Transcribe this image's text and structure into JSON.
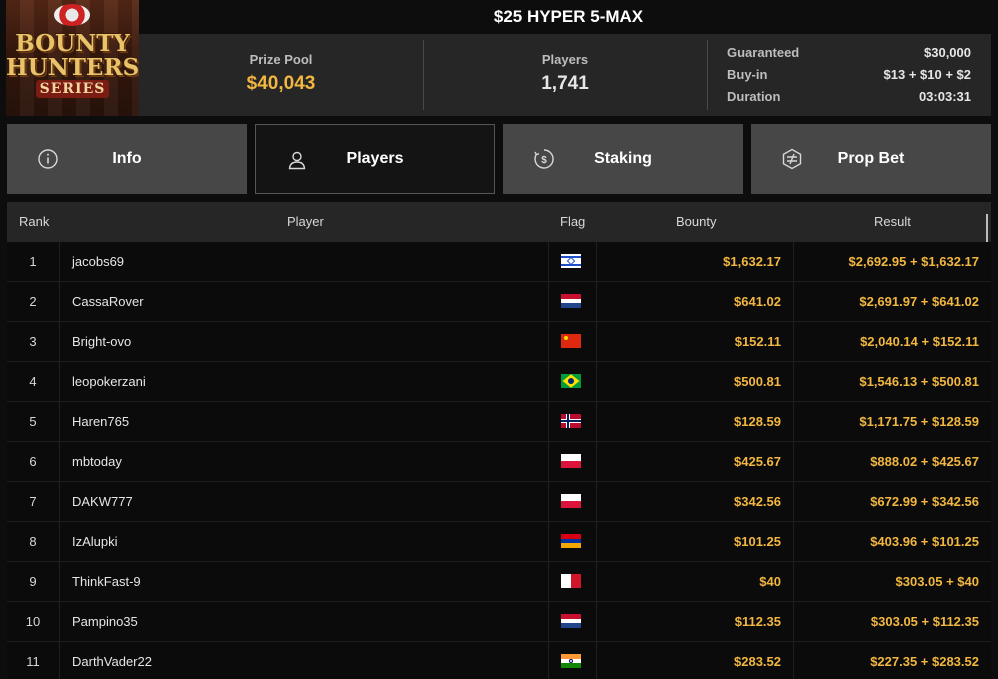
{
  "logo": {
    "line1": "BOUNTY",
    "line2": "HUNTERS",
    "line3": "SERIES"
  },
  "tournament": {
    "title": "$25 HYPER 5-MAX"
  },
  "stats": {
    "prize_pool_label": "Prize Pool",
    "prize_pool_value": "$40,043",
    "players_label": "Players",
    "players_value": "1,741",
    "guaranteed_label": "Guaranteed",
    "guaranteed_value": "$30,000",
    "buyin_label": "Buy-in",
    "buyin_value": "$13 + $10 + $2",
    "duration_label": "Duration",
    "duration_value": "03:03:31"
  },
  "tabs": [
    {
      "label": "Info",
      "icon": "info-icon",
      "active": false
    },
    {
      "label": "Players",
      "icon": "user-icon",
      "active": true
    },
    {
      "label": "Staking",
      "icon": "staking-icon",
      "active": false
    },
    {
      "label": "Prop Bet",
      "icon": "prop-bet-icon",
      "active": false
    }
  ],
  "table": {
    "headers": {
      "rank": "Rank",
      "player": "Player",
      "flag": "Flag",
      "bounty": "Bounty",
      "result": "Result"
    },
    "rows": [
      {
        "rank": "1",
        "player": "jacobs69",
        "flag": "israel-flag",
        "bounty": "$1,632.17",
        "result": "$2,692.95 + $1,632.17"
      },
      {
        "rank": "2",
        "player": "CassaRover",
        "flag": "netherlands-flag",
        "bounty": "$641.02",
        "result": "$2,691.97 + $641.02"
      },
      {
        "rank": "3",
        "player": "Bright-ovo",
        "flag": "china-flag",
        "bounty": "$152.11",
        "result": "$2,040.14 + $152.11"
      },
      {
        "rank": "4",
        "player": "leopokerzani",
        "flag": "brazil-flag",
        "bounty": "$500.81",
        "result": "$1,546.13 + $500.81"
      },
      {
        "rank": "5",
        "player": "Haren765",
        "flag": "norway-flag",
        "bounty": "$128.59",
        "result": "$1,171.75 + $128.59"
      },
      {
        "rank": "6",
        "player": "mbtoday",
        "flag": "poland-flag",
        "bounty": "$425.67",
        "result": "$888.02 + $425.67"
      },
      {
        "rank": "7",
        "player": "DAKW777",
        "flag": "poland-flag",
        "bounty": "$342.56",
        "result": "$672.99 + $342.56"
      },
      {
        "rank": "8",
        "player": "IzAlupki",
        "flag": "armenia-flag",
        "bounty": "$101.25",
        "result": "$403.96 + $101.25"
      },
      {
        "rank": "9",
        "player": "ThinkFast-9",
        "flag": "malta-flag",
        "bounty": "$40",
        "result": "$303.05 + $40"
      },
      {
        "rank": "10",
        "player": "Pampino35",
        "flag": "netherlands-flag",
        "bounty": "$112.35",
        "result": "$303.05 + $112.35"
      },
      {
        "rank": "11",
        "player": "DarthVader22",
        "flag": "india-flag",
        "bounty": "$283.52",
        "result": "$227.35 + $283.52"
      }
    ]
  }
}
